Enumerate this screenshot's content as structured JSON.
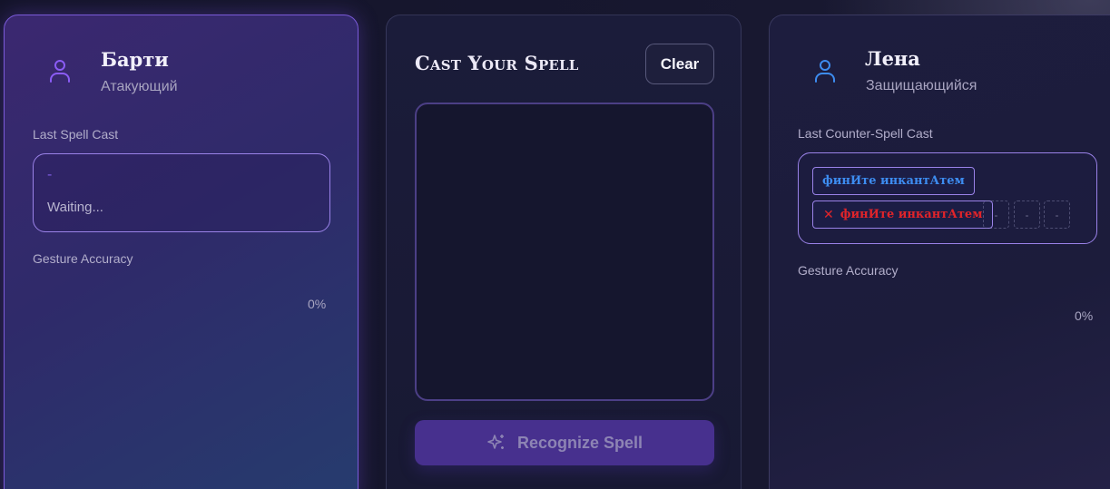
{
  "attacker": {
    "name": "Барти",
    "role": "Атакующий",
    "avatar_icon": "user-icon",
    "last_spell_label": "Last Spell Cast",
    "last_spell_value": "-",
    "last_spell_status": "Waiting...",
    "accuracy_label": "Gesture Accuracy",
    "accuracy_value": "0%",
    "accent_color": "#7c5ce0"
  },
  "caster": {
    "title": "Cast Your Spell",
    "clear_label": "Clear",
    "recognize_label": "Recognize Spell",
    "recognize_icon": "sparkles-icon"
  },
  "defender": {
    "name": "Лена",
    "role": "Защищающийся",
    "avatar_icon": "user-icon",
    "last_counter_label": "Last Counter-Spell Cast",
    "target_spell": "финИте инкантАтем",
    "attempt": {
      "mark": "✕",
      "text": "финИте инкантАтем"
    },
    "slots": [
      "-",
      "-",
      "-"
    ],
    "accuracy_label": "Gesture Accuracy",
    "accuracy_value": "0%",
    "accent_color": "#3d8cf0"
  }
}
